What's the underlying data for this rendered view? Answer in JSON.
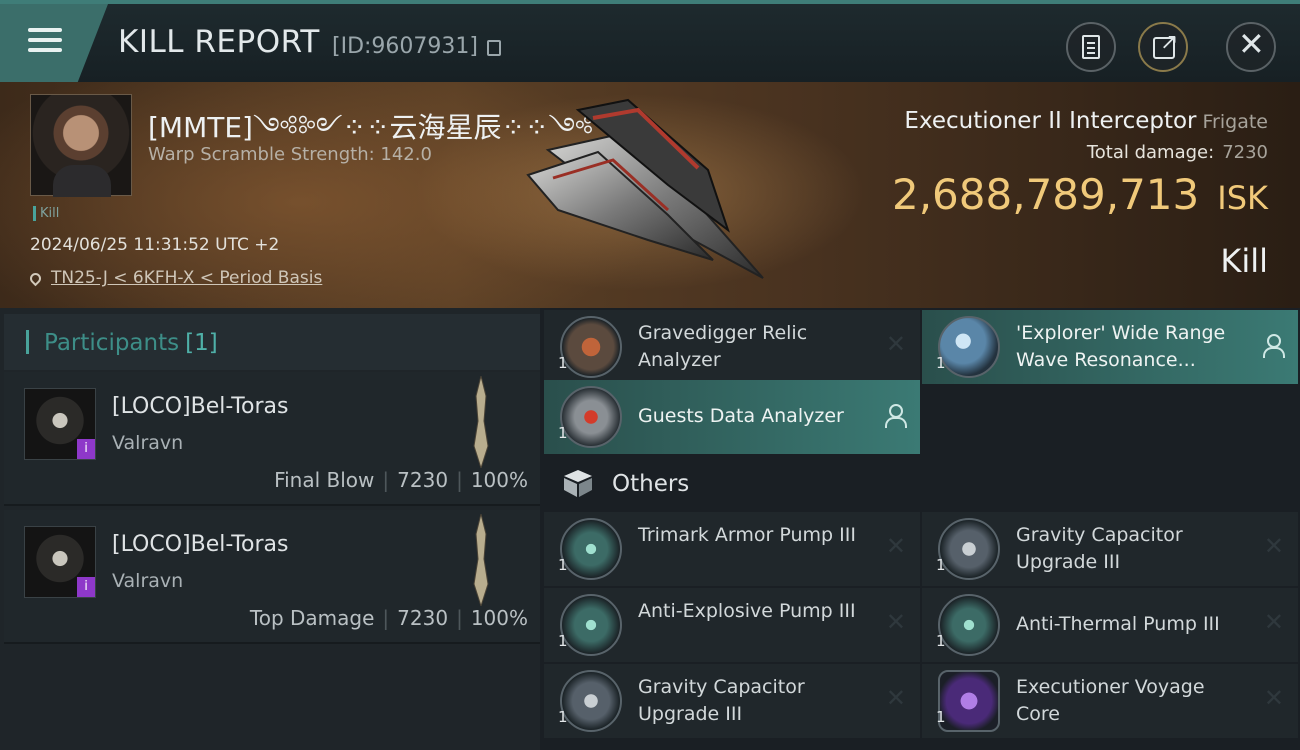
{
  "header": {
    "title": "KILL REPORT",
    "report_id": "[ID:9607931]"
  },
  "victim": {
    "name": "[MMTE]༺༻⁘⁘云海星辰⁘⁘༺",
    "warp_strength": "Warp Scramble Strength: 142.0",
    "tag": "Kill",
    "datetime": "2024/06/25 11:31:52 UTC +2",
    "location": "TN25-J < 6KFH-X < Period Basis",
    "ship_name": "Executioner II Interceptor",
    "ship_class": "Frigate",
    "total_damage_label": "Total damage:",
    "total_damage_value": "7230",
    "isk_value": "2,688,789,713",
    "isk_currency": "ISK",
    "result": "Kill"
  },
  "participants": {
    "title": "Participants",
    "count": "[1]",
    "items": [
      {
        "name": "[LOCO]Bel-Toras",
        "ship": "Valravn",
        "role": "Final Blow",
        "damage": "7230",
        "percent": "100%",
        "badge": "i"
      },
      {
        "name": "[LOCO]Bel-Toras",
        "ship": "Valravn",
        "role": "Top Damage",
        "damage": "7230",
        "percent": "100%",
        "badge": "i"
      }
    ]
  },
  "modules": {
    "top": [
      {
        "name": "Gravedigger Relic Analyzer",
        "qty": "1",
        "state": "destroyed"
      },
      {
        "name": "'Explorer' Wide Range Wave Resonance...",
        "qty": "1",
        "state": "dropped"
      },
      {
        "name": "Guests Data Analyzer",
        "qty": "1",
        "state": "dropped"
      }
    ],
    "others_label": "Others",
    "others": [
      {
        "name": "Trimark Armor Pump III",
        "qty": "1",
        "state": "destroyed"
      },
      {
        "name": "Gravity Capacitor Upgrade III",
        "qty": "1",
        "state": "destroyed"
      },
      {
        "name": "Anti-Explosive Pump III",
        "qty": "1",
        "state": "destroyed"
      },
      {
        "name": "Anti-Thermal Pump III",
        "qty": "1",
        "state": "destroyed"
      },
      {
        "name": "Gravity Capacitor Upgrade III",
        "qty": "1",
        "state": "destroyed"
      },
      {
        "name": "Executioner Voyage Core",
        "qty": "1",
        "state": "destroyed"
      }
    ],
    "destroyed_symbol": "✕"
  },
  "colors": {
    "accent_teal": "#3b7a74",
    "isk_gold": "#f0c97a",
    "badge_purple": "#8e38c9"
  },
  "icons": [
    "menu-icon",
    "copy-icon",
    "clipboard-icon",
    "share-icon",
    "close-icon",
    "location-pin-icon",
    "person-icon",
    "cube-icon"
  ]
}
